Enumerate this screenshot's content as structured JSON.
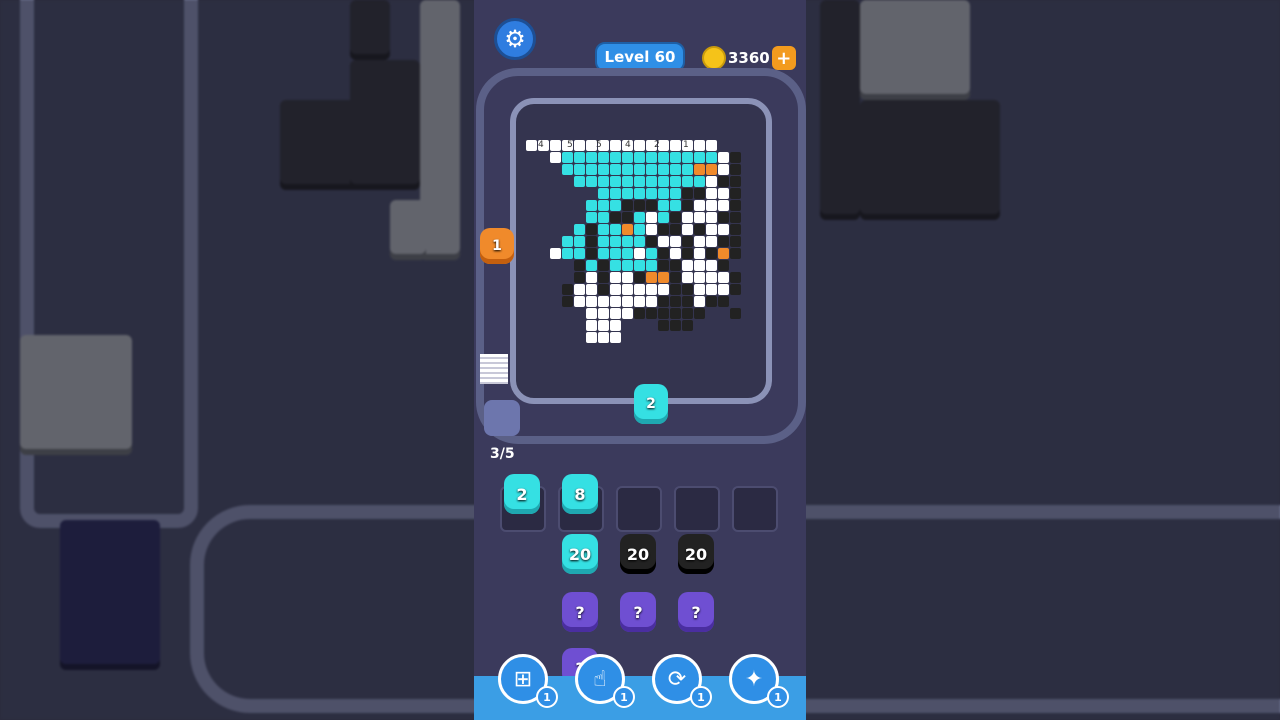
{
  "header": {
    "level_label": "Level 60",
    "coins": "3360",
    "plus_label": "+"
  },
  "board": {
    "column_hints": [
      "4",
      "5",
      "5",
      "4",
      "2",
      "1"
    ]
  },
  "conveyor": {
    "counter": "3/5",
    "orange_shooter": "1",
    "moving_shooter": "2"
  },
  "queue": {
    "slots": [
      {
        "count": "2",
        "color": "teal"
      },
      {
        "count": "8",
        "color": "teal"
      },
      {
        "count": "",
        "color": "empty"
      },
      {
        "count": "",
        "color": "empty"
      },
      {
        "count": "",
        "color": "empty"
      }
    ],
    "row1": [
      {
        "count": "20",
        "color": "teal"
      },
      {
        "count": "20",
        "color": "black"
      },
      {
        "count": "20",
        "color": "black"
      }
    ],
    "row2": [
      {
        "count": "?",
        "color": "mystery"
      },
      {
        "count": "?",
        "color": "mystery"
      },
      {
        "count": "?",
        "color": "mystery"
      }
    ],
    "row3": [
      {
        "count": "?",
        "color": "mystery"
      }
    ]
  },
  "tools": [
    {
      "icon": "add-slot-icon",
      "count": "1"
    },
    {
      "icon": "hand-icon",
      "count": "1"
    },
    {
      "icon": "shuffle-icon",
      "count": "1"
    },
    {
      "icon": "magic-icon",
      "count": "1"
    }
  ],
  "colors": {
    "teal": "#35e0e3",
    "black": "#222222",
    "white": "#ffffff",
    "orange": "#f08a2b",
    "accent": "#2f8fe6"
  }
}
